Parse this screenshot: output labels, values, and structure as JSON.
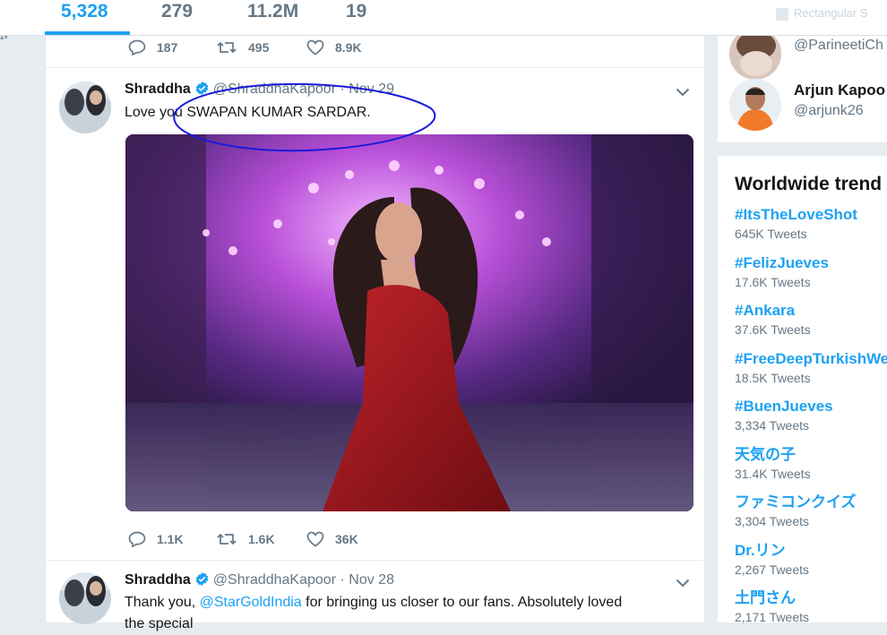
{
  "stats": [
    {
      "value": "5,328",
      "active": true
    },
    {
      "value": "279",
      "active": false
    },
    {
      "value": "11.2M",
      "active": false
    },
    {
      "value": "19",
      "active": false
    }
  ],
  "topbar_ghost": "Rectangular S",
  "colors": {
    "accent": "#1da1f2",
    "muted": "#657786",
    "annotation": "#1a1adb"
  },
  "prev_tweet_actions": {
    "replies": "187",
    "retweets": "495",
    "likes": "8.9K"
  },
  "tweets": [
    {
      "name": "Shraddha",
      "handle": "@ShraddhaKapoor",
      "dot": "·",
      "time": "Nov 29",
      "text": "Love you SWAPAN KUMAR SARDAR.",
      "replies": "1.1K",
      "retweets": "1.6K",
      "likes": "36K"
    },
    {
      "name": "Shraddha",
      "handle": "@ShraddhaKapoor",
      "dot": "·",
      "time": "Nov 28",
      "text_before": "Thank you, ",
      "mention": "@StarGoldIndia",
      "text_after": " for bringing us closer to our fans. Absolutely loved",
      "text_line2": "the special"
    }
  ],
  "who_to_follow": [
    {
      "name": "",
      "handle": "@ParineetiCh"
    },
    {
      "name": "Arjun Kapoo",
      "handle": "@arjunk26"
    }
  ],
  "trends": {
    "title": "Worldwide trend",
    "items": [
      {
        "name": "#ItsTheLoveShot",
        "count": "645K Tweets"
      },
      {
        "name": "#FelizJueves",
        "count": "17.6K Tweets"
      },
      {
        "name": "#Ankara",
        "count": "37.6K Tweets"
      },
      {
        "name": "#FreeDeepTurkishWe",
        "count": "18.5K Tweets"
      },
      {
        "name": "#BuenJueves",
        "count": "3,334 Tweets"
      },
      {
        "name": "天気の子",
        "count": "31.4K Tweets"
      },
      {
        "name": "ファミコンクイズ",
        "count": "3,304 Tweets"
      },
      {
        "name": "Dr.リン",
        "count": "2,267 Tweets"
      },
      {
        "name": "土門さん",
        "count": "2,171 Tweets"
      }
    ]
  }
}
